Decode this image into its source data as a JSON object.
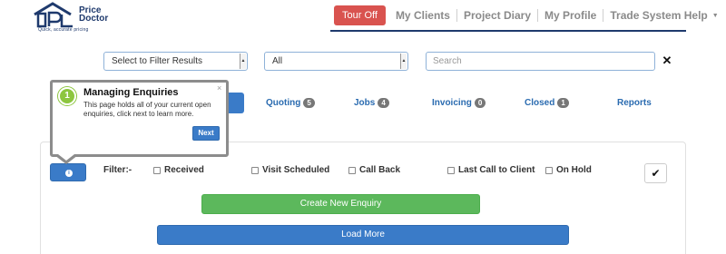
{
  "header": {
    "brand_line1": "Price",
    "brand_line2": "Doctor",
    "tagline": "Quick, accurate pricing",
    "tour_button": "Tour Off",
    "nav": [
      "My Clients",
      "Project Diary",
      "My Profile",
      "Trade System Help"
    ],
    "accent_color": "#1f3a6d"
  },
  "filters": {
    "filter_select": "Select to Filter Results",
    "status_select": "All",
    "search_placeholder": "Search",
    "clear_icon": "close-icon"
  },
  "tabs": [
    {
      "label": "Quoting",
      "count": "5"
    },
    {
      "label": "Jobs",
      "count": "4"
    },
    {
      "label": "Invoicing",
      "count": "0"
    },
    {
      "label": "Closed",
      "count": "1"
    },
    {
      "label": "Reports",
      "count": null
    }
  ],
  "panel": {
    "filter_label": "Filter:-",
    "checkboxes": [
      "Received",
      "Visit Scheduled",
      "Call Back",
      "Last Call to Client",
      "On Hold"
    ],
    "create_button": "Create New Enquiry",
    "load_button": "Load More"
  },
  "tour": {
    "step": "1",
    "title": "Managing Enquiries",
    "body": "This page holds all of your current open enquiries, click next to learn more.",
    "close": "×",
    "next_button": "Next"
  }
}
